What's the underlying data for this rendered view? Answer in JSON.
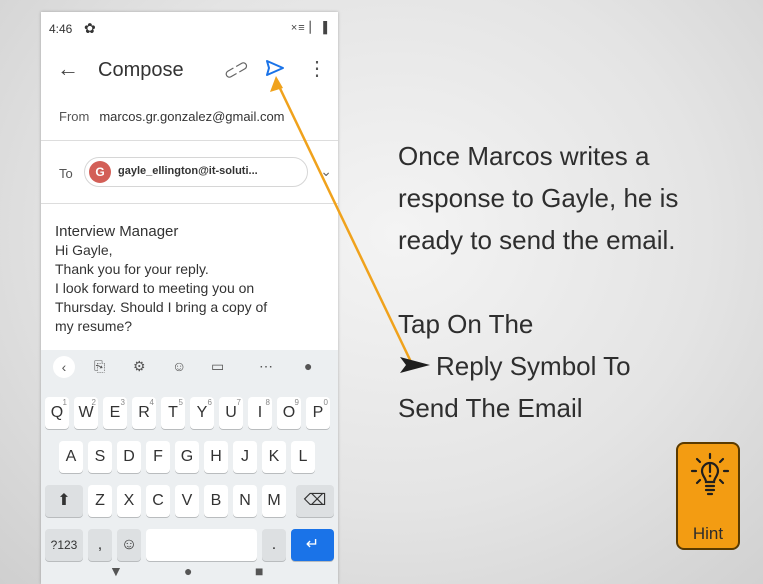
{
  "status": {
    "time": "4:46",
    "icons": "×≡ ▏▐"
  },
  "appbar": {
    "back": "←",
    "title": "Compose",
    "more": "⋮"
  },
  "from": {
    "label": "From",
    "address": "marcos.gr.gonzalez@gmail.com"
  },
  "to": {
    "label": "To",
    "avatar_letter": "G",
    "recipient": "gayle_ellington@it-soluti...",
    "chevron": "⌄"
  },
  "email": {
    "subject": "Interview Manager",
    "lines": [
      "Hi Gayle,",
      "Thank you for your reply.",
      "I look forward to meeting you on",
      "Thursday. Should I bring a  copy of",
      "my resume?"
    ]
  },
  "keyboard": {
    "tools": [
      "‹",
      "⎘",
      "⚙",
      "☺",
      "▭",
      "⋯",
      "●"
    ],
    "row1": [
      {
        "k": "Q",
        "n": "1"
      },
      {
        "k": "W",
        "n": "2"
      },
      {
        "k": "E",
        "n": "3"
      },
      {
        "k": "R",
        "n": "4"
      },
      {
        "k": "T",
        "n": "5"
      },
      {
        "k": "Y",
        "n": "6"
      },
      {
        "k": "U",
        "n": "7"
      },
      {
        "k": "I",
        "n": "8"
      },
      {
        "k": "O",
        "n": "9"
      },
      {
        "k": "P",
        "n": "0"
      }
    ],
    "row2": [
      "A",
      "S",
      "D",
      "F",
      "G",
      "H",
      "J",
      "K",
      "L"
    ],
    "row3": [
      "Z",
      "X",
      "C",
      "V",
      "B",
      "N",
      "M"
    ],
    "shift": "⬆",
    "backspace": "⌫",
    "sym": "?123",
    "comma": ",",
    "emoji": "☺",
    "period": ".",
    "enter": "↵"
  },
  "nav": {
    "back": "▼",
    "home": "●",
    "recent": "■"
  },
  "instructions": {
    "lines": [
      "Once Marcos writes a",
      "response to Gayle, he is",
      "ready to send the email."
    ],
    "tap": "Tap On The",
    "reply": "Reply Symbol To",
    "send": "Send The Email"
  },
  "hint": {
    "label": "Hint"
  },
  "colors": {
    "send_icon": "#1a73e8",
    "arrow": "#f0a21c",
    "hint_bg": "#f39c12"
  }
}
